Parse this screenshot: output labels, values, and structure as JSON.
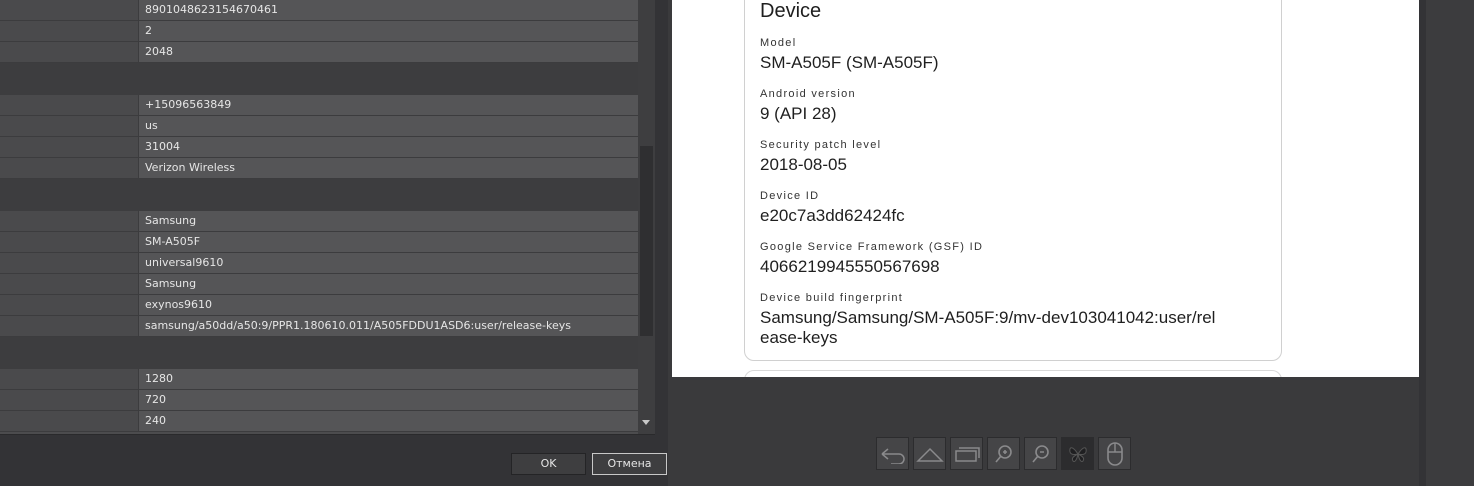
{
  "properties": {
    "group1": [
      "8901048623154670461",
      "2",
      "2048"
    ],
    "group2": [
      "+15096563849",
      "us",
      "31004",
      "Verizon Wireless"
    ],
    "group3": [
      "Samsung",
      "SM-A505F",
      "universal9610",
      "Samsung",
      "exynos9610",
      "samsung/a50dd/a50:9/PPR1.180610.011/A505FDDU1ASD6:user/release-keys"
    ],
    "group4": [
      "1280",
      "720",
      "240"
    ]
  },
  "dialog": {
    "ok_label": "OK",
    "cancel_label": "Отмена"
  },
  "device_card": {
    "title": "Device",
    "fields": [
      {
        "label": "Model",
        "value": "SM-A505F (SM-A505F)"
      },
      {
        "label": "Android version",
        "value": "9 (API 28)"
      },
      {
        "label": "Security patch level",
        "value": "2018-08-05"
      },
      {
        "label": "Device ID",
        "value": "e20c7a3dd62424fc"
      },
      {
        "label": "Google Service Framework (GSF) ID",
        "value": "4066219945550567698"
      },
      {
        "label": "Device build fingerprint",
        "value": "Samsung/Samsung/SM-A505F:9/mv-dev103041042:user/release-keys"
      }
    ]
  },
  "toolbar": {
    "icons": [
      "back-icon",
      "home-icon",
      "recent-apps-icon",
      "zoom-in-icon",
      "zoom-out-icon",
      "butterfly-icon",
      "mouse-icon"
    ]
  },
  "colors": {
    "grid_value_bg": "#555557",
    "grid_category_bg": "#3d3d3f",
    "text_light": "#e6e6e6",
    "screen_bg": "#ffffff"
  }
}
